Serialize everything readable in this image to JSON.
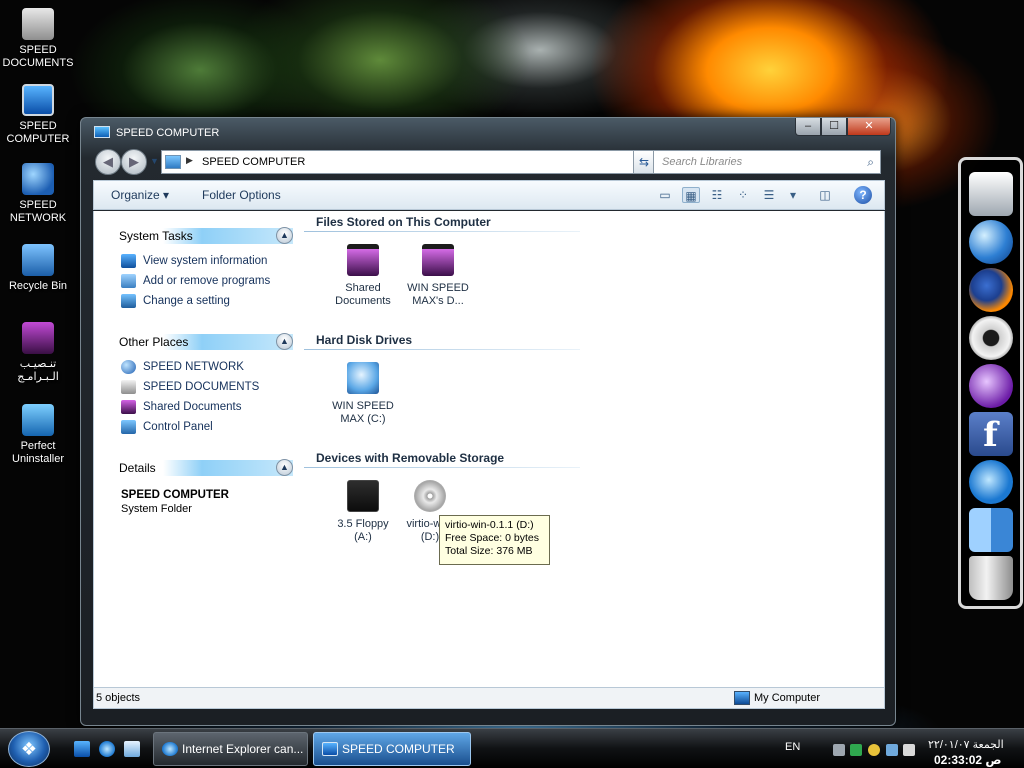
{
  "desktop": {
    "icons": [
      {
        "label": "SPEED\nDOCUMENTS",
        "icon": "documents-icon"
      },
      {
        "label": "SPEED\nCOMPUTER",
        "icon": "computer-icon"
      },
      {
        "label": "SPEED\nNETWORK",
        "icon": "network-icon"
      },
      {
        "label": "Recycle Bin",
        "icon": "recycle-bin-icon"
      },
      {
        "label": "تنـصيـب\nالـبـرامـج",
        "icon": "folder-icon"
      },
      {
        "label": "Perfect\nUninstaller",
        "icon": "uninstaller-icon"
      }
    ]
  },
  "window": {
    "title": "SPEED COMPUTER",
    "buttons": {
      "minimize": "–",
      "maximize": "☐",
      "close": "✕"
    }
  },
  "address": {
    "path": "SPEED COMPUTER",
    "search_placeholder": "Search Libraries"
  },
  "toolbar": {
    "organize": "Organize ▾",
    "folder_options": "Folder Options",
    "help": "?"
  },
  "tasks": {
    "system": {
      "title": "System Tasks",
      "items": [
        "View system information",
        "Add or remove programs",
        "Change a setting"
      ]
    },
    "other": {
      "title": "Other Places",
      "items": [
        "SPEED NETWORK",
        "SPEED DOCUMENTS",
        "Shared Documents",
        "Control Panel"
      ]
    },
    "details": {
      "title": "Details",
      "name": "SPEED COMPUTER",
      "type": "System Folder"
    }
  },
  "groups": {
    "files": {
      "title": "Files Stored on This Computer",
      "items": [
        {
          "line1": "Shared",
          "line2": "Documents"
        },
        {
          "line1": "WIN SPEED",
          "line2": "MAX's D..."
        }
      ]
    },
    "drives": {
      "title": "Hard Disk Drives",
      "items": [
        {
          "line1": "WIN SPEED",
          "line2": "MAX (C:)"
        }
      ]
    },
    "removable": {
      "title": "Devices with Removable Storage",
      "items": [
        {
          "line1": "3.5 Floppy",
          "line2": "(A:)"
        },
        {
          "line1": "virtio-win-",
          "line2": "(D:)"
        }
      ]
    }
  },
  "tooltip": {
    "line1": "virtio-win-0.1.1 (D:)",
    "line2": "Free Space: 0 bytes",
    "line3": "Total Size: 376 MB"
  },
  "status": {
    "left": "5 objects",
    "right": "My Computer"
  },
  "dock": {
    "items": [
      "computer-icon",
      "globe-icon",
      "firefox-icon",
      "settings-gear-icon",
      "yahoo-messenger-icon",
      "facebook-icon",
      "internet-explorer-icon",
      "finder-icon",
      "trash-icon"
    ],
    "facebook_glyph": "f"
  },
  "taskbar": {
    "start_glyph": "❖",
    "tasks": [
      {
        "label": "Internet Explorer can..."
      },
      {
        "label": "SPEED COMPUTER"
      }
    ],
    "language": "EN",
    "date": "الجمعة ٢٢/٠١/٠٧",
    "time": "02:33:02 ص"
  }
}
